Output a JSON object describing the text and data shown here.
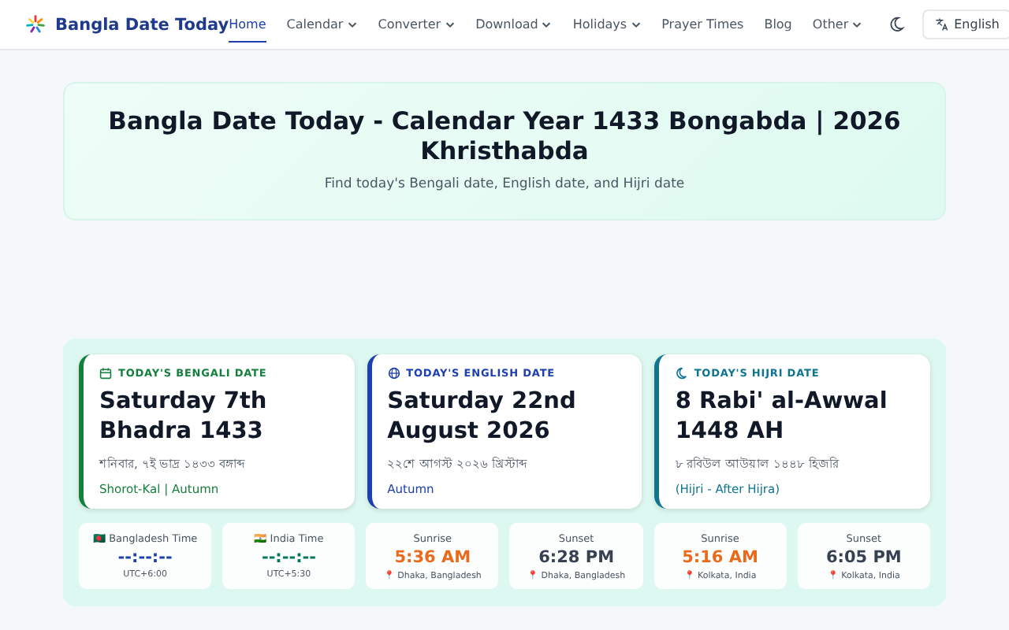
{
  "brand": {
    "name": "Bangla Date Today"
  },
  "nav": [
    {
      "label": "Home",
      "selected": true,
      "dropdown": false
    },
    {
      "label": "Calendar",
      "selected": false,
      "dropdown": true
    },
    {
      "label": "Converter",
      "selected": false,
      "dropdown": true
    },
    {
      "label": "Download",
      "selected": false,
      "dropdown": true
    },
    {
      "label": "Holidays",
      "selected": false,
      "dropdown": true
    },
    {
      "label": "Prayer Times",
      "selected": false,
      "dropdown": false
    },
    {
      "label": "Blog",
      "selected": false,
      "dropdown": false
    },
    {
      "label": "Other",
      "selected": false,
      "dropdown": true
    }
  ],
  "language_button": "English",
  "hero": {
    "title": "Bangla Date Today - Calendar Year 1433 Bongabda | 2026 Khristhabda",
    "subtitle": "Find today's Bengali date, English date, and Hijri date"
  },
  "date_cards": [
    {
      "kind": "calendar",
      "label": "TODAY'S BENGALI DATE",
      "date": "Saturday 7th Bhadra 1433",
      "native": "শনিবার, ৭ই ভাদ্র ১৪৩৩ বঙ্গাব্দ",
      "note": "Shorot-Kal | Autumn",
      "color": "#15803d"
    },
    {
      "kind": "globe",
      "label": "TODAY'S ENGLISH DATE",
      "date": "Saturday 22nd August 2026",
      "native": "২২শে আগস্ট ২০২৬ খ্রিস্টাব্দ",
      "note": "Autumn",
      "color": "#1e40af"
    },
    {
      "kind": "moon",
      "label": "TODAY'S HIJRI DATE",
      "date": "8 Rabi' al-Awwal 1448 AH",
      "native": "৮ রবিউল আউয়াল ১৪৪৮ হিজরি",
      "note": "(Hijri - After Hijra)",
      "color": "#0e7490"
    }
  ],
  "time_cards": [
    {
      "label": "🇧🇩 Bangladesh Time",
      "value": "--:--:--",
      "sub": "UTC+6:00",
      "color": "#1e40af"
    },
    {
      "label": "🇮🇳 India Time",
      "value": "--:--:--",
      "sub": "UTC+5:30",
      "color": "#047857"
    },
    {
      "label": "Sunrise",
      "value": "5:36 AM",
      "sub": "📍 Dhaka, Bangladesh",
      "color": "#ea6a1c"
    },
    {
      "label": "Sunset",
      "value": "6:28 PM",
      "sub": "📍 Dhaka, Bangladesh",
      "color": "#374151"
    },
    {
      "label": "Sunrise",
      "value": "5:16 AM",
      "sub": "📍 Kolkata, India",
      "color": "#ea6a1c"
    },
    {
      "label": "Sunset",
      "value": "6:05 PM",
      "sub": "📍 Kolkata, India",
      "color": "#374151"
    }
  ]
}
